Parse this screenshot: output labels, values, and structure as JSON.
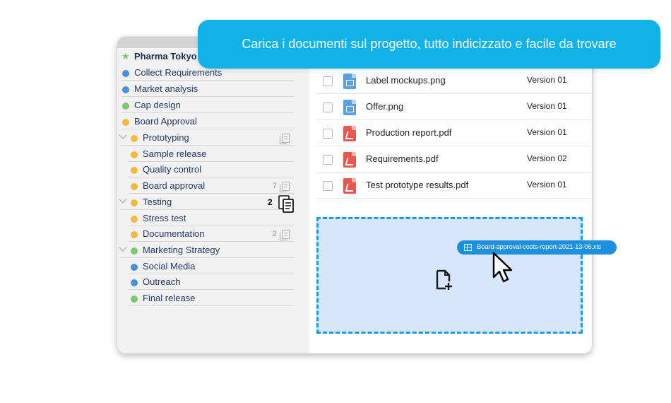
{
  "banner": {
    "text": "Carica i documenti sul progetto, tutto indicizzato e facile da trovare"
  },
  "sidebar": {
    "project": {
      "label": "Pharma Tokyo",
      "icon": "star-icon",
      "color": "#7bc96f"
    },
    "items": [
      {
        "label": "Collect Requirements",
        "color": "#4a90d9"
      },
      {
        "label": "Market analysis",
        "color": "#4a90d9"
      },
      {
        "label": "Cap design",
        "color": "#7bc96f"
      },
      {
        "label": "Board Approval",
        "color": "#f2b93b"
      },
      {
        "label": "Prototyping",
        "color": "#f2b93b",
        "expanded": true
      },
      {
        "label": "Sample release",
        "color": "#f2b93b"
      },
      {
        "label": "Quality control",
        "color": "#f2b93b"
      },
      {
        "label": "Board approval",
        "color": "#f2b93b",
        "count": "7"
      },
      {
        "label": "Testing",
        "color": "#f2b93b",
        "expanded": true
      },
      {
        "label": "Stress test",
        "color": "#f2b93b"
      },
      {
        "label": "Documentation",
        "color": "#f2b93b",
        "count": "2"
      },
      {
        "label": "Marketing Strategy",
        "color": "#7bc96f",
        "expanded": true
      },
      {
        "label": "Social Media",
        "color": "#4a90d9"
      },
      {
        "label": "Outreach",
        "color": "#4a90d9"
      },
      {
        "label": "Final release",
        "color": "#7bc96f"
      }
    ]
  },
  "files": [
    {
      "name": "Label mockups.png",
      "version": "Version 01",
      "type": "image"
    },
    {
      "name": "Offer.png",
      "version": "Version 01",
      "type": "image"
    },
    {
      "name": "Production report.pdf",
      "version": "Version 01",
      "type": "pdf"
    },
    {
      "name": "Requirements.pdf",
      "version": "Version 02",
      "type": "pdf"
    },
    {
      "name": "Test prototype results.pdf",
      "version": "Version 01",
      "type": "pdf"
    }
  ],
  "drag": {
    "count": "2",
    "file_name": "Board-approval-costs-report-2021-13-06.xls"
  },
  "colors": {
    "accent": "#10b3e8",
    "dropzone_border": "#1a9be6",
    "dropzone_fill": "#d8e6fb"
  }
}
